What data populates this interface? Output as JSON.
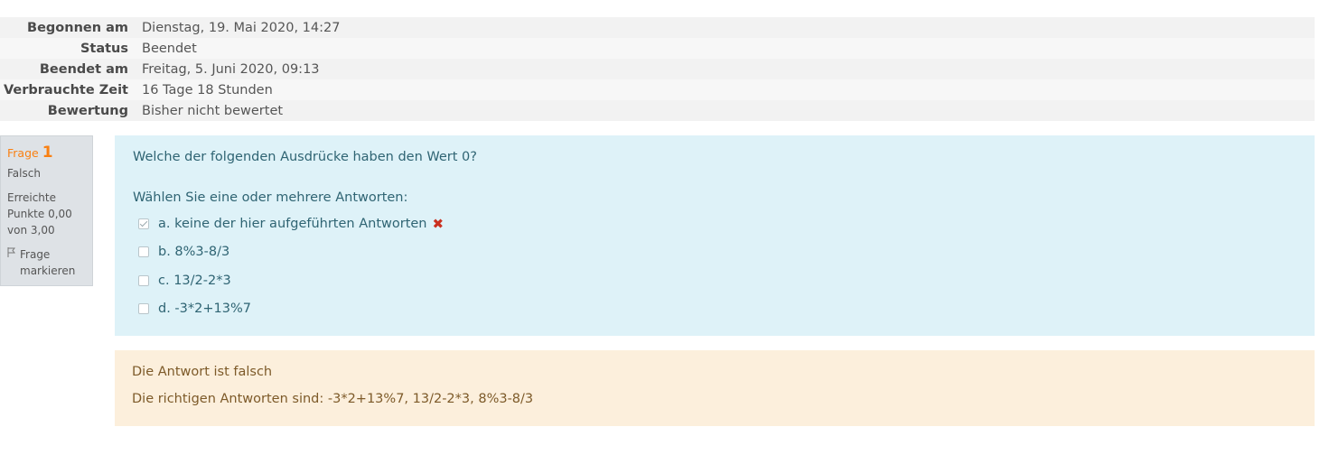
{
  "summary": {
    "rows": [
      {
        "label": "Begonnen am",
        "value": "Dienstag, 19. Mai 2020, 14:27"
      },
      {
        "label": "Status",
        "value": "Beendet"
      },
      {
        "label": "Beendet am",
        "value": "Freitag, 5. Juni 2020, 09:13"
      },
      {
        "label": "Verbrauchte Zeit",
        "value": "16 Tage 18 Stunden"
      },
      {
        "label": "Bewertung",
        "value": "Bisher nicht bewertet"
      }
    ]
  },
  "question_info": {
    "prefix": "Frage",
    "number": "1",
    "state": "Falsch",
    "grade": "Erreichte Punkte 0,00 von 3,00",
    "flag_label": "Frage markieren",
    "accent_color": "#f98012"
  },
  "question": {
    "text": "Welche der folgenden Ausdrücke haben den Wert 0?",
    "prompt": "Wählen Sie eine oder mehrere Antworten:",
    "answers": [
      {
        "label": "a. keine der hier aufgeführten Antworten",
        "checked": true,
        "incorrect": true
      },
      {
        "label": "b. 8%3-8/3",
        "checked": false
      },
      {
        "label": "c. 13/2-2*3",
        "checked": false
      },
      {
        "label": "d. -3*2+13%7",
        "checked": false
      }
    ],
    "incorrect_icon": "✖"
  },
  "feedback": {
    "result": "Die Antwort ist falsch",
    "correct_answers": "Die richtigen Antworten sind: -3*2+13%7, 13/2-2*3, 8%3-8/3"
  },
  "colors": {
    "formulation_bg": "#def2f8",
    "feedback_bg": "#fcefdc",
    "incorrect": "#ca3120"
  }
}
